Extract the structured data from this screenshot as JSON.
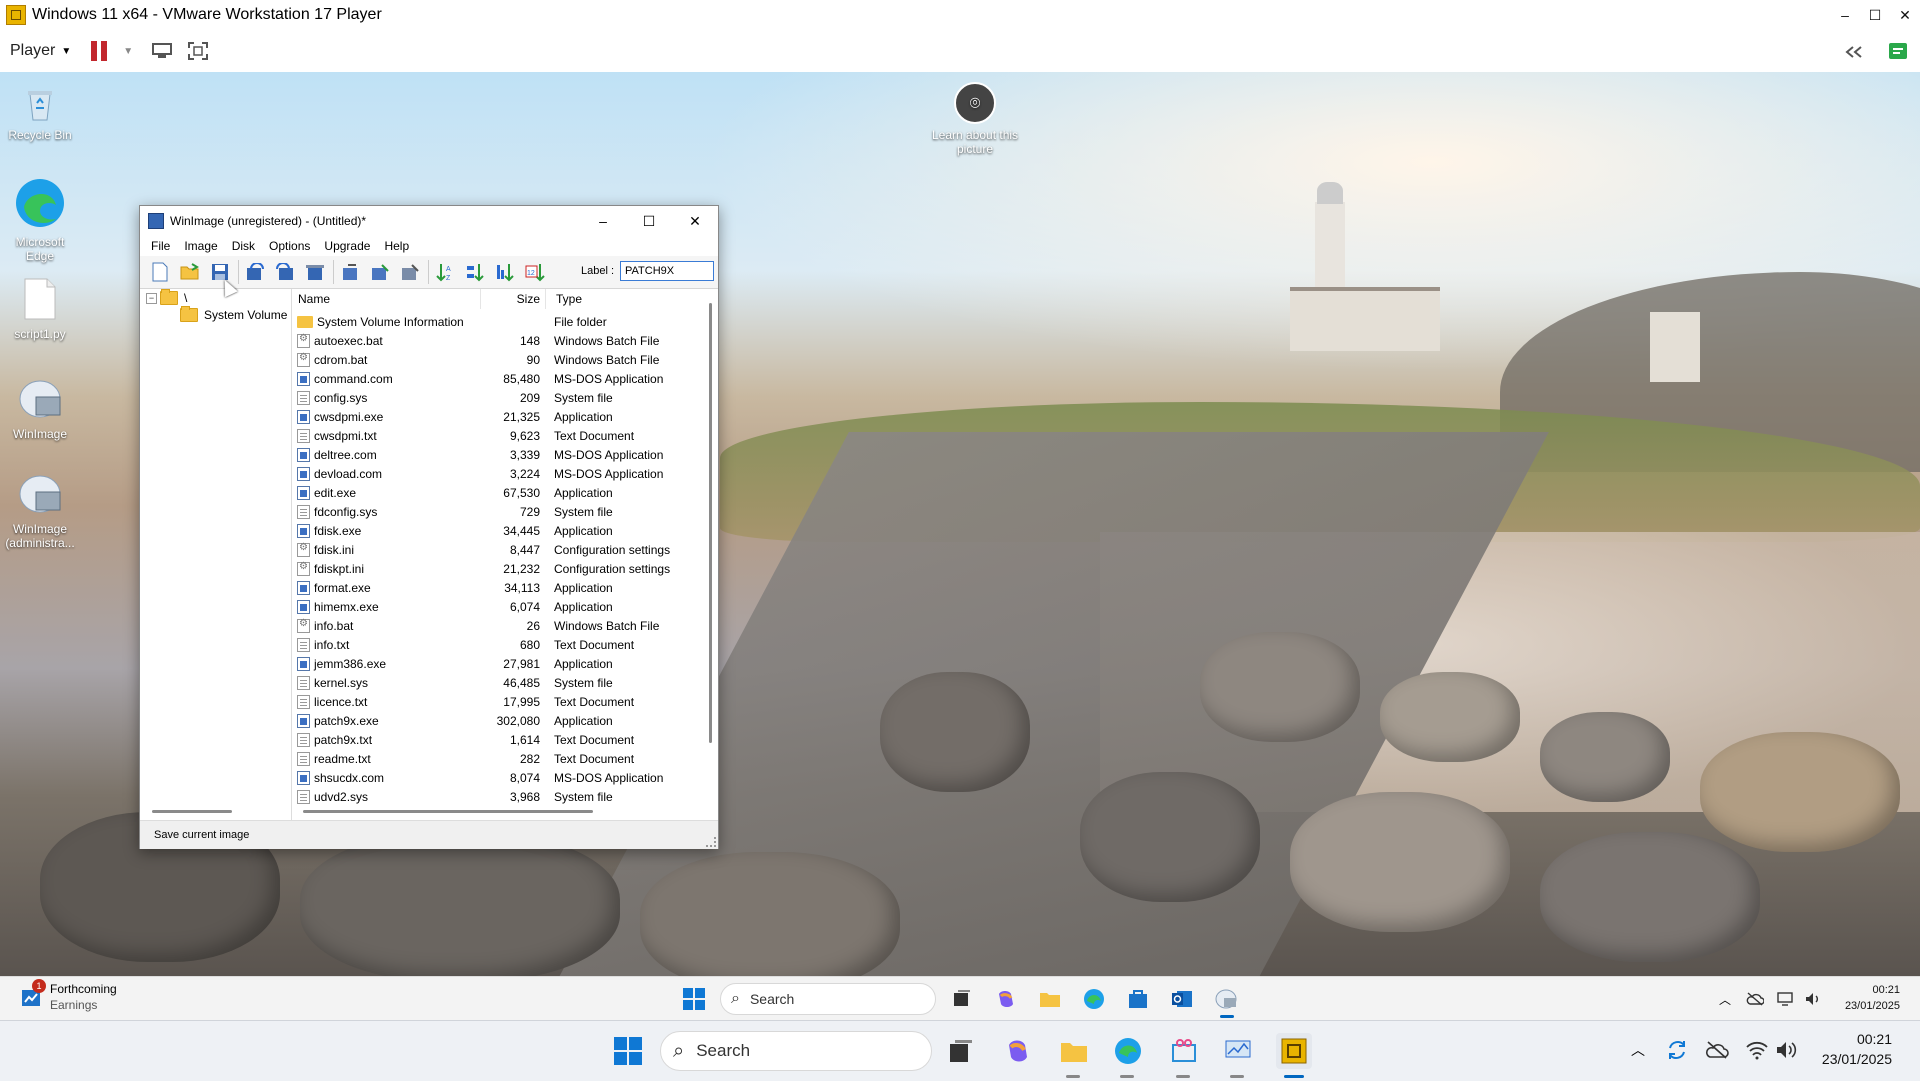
{
  "host": {
    "title": "Windows 11 x64 - VMware Workstation 17 Player",
    "player_menu": "Player",
    "window_buttons": [
      "–",
      "☐",
      "✕"
    ]
  },
  "desktop": {
    "icons": [
      {
        "label": "Recycle Bin"
      },
      {
        "label": "Microsoft Edge"
      },
      {
        "label": "script1.py"
      },
      {
        "label": "WinImage"
      },
      {
        "label": "WinImage (administra..."
      }
    ],
    "learn": "Learn about this picture"
  },
  "winimage": {
    "title": "WinImage (unregistered) - (Untitled)*",
    "menu": [
      "File",
      "Image",
      "Disk",
      "Options",
      "Upgrade",
      "Help"
    ],
    "label_caption": "Label :",
    "label_value": "PATCH9X",
    "tree": {
      "root": "\\",
      "child": "System Volume I"
    },
    "columns": {
      "name": "Name",
      "size": "Size",
      "type": "Type"
    },
    "files": [
      {
        "name": "System Volume Information",
        "size": "",
        "type": "File folder",
        "icon": "folder"
      },
      {
        "name": "autoexec.bat",
        "size": "148",
        "type": "Windows Batch File",
        "icon": "bat"
      },
      {
        "name": "cdrom.bat",
        "size": "90",
        "type": "Windows Batch File",
        "icon": "bat"
      },
      {
        "name": "command.com",
        "size": "85,480",
        "type": "MS-DOS Application",
        "icon": "app"
      },
      {
        "name": "config.sys",
        "size": "209",
        "type": "System file",
        "icon": "doc"
      },
      {
        "name": "cwsdpmi.exe",
        "size": "21,325",
        "type": "Application",
        "icon": "app"
      },
      {
        "name": "cwsdpmi.txt",
        "size": "9,623",
        "type": "Text Document",
        "icon": "doc"
      },
      {
        "name": "deltree.com",
        "size": "3,339",
        "type": "MS-DOS Application",
        "icon": "app"
      },
      {
        "name": "devload.com",
        "size": "3,224",
        "type": "MS-DOS Application",
        "icon": "app"
      },
      {
        "name": "edit.exe",
        "size": "67,530",
        "type": "Application",
        "icon": "app"
      },
      {
        "name": "fdconfig.sys",
        "size": "729",
        "type": "System file",
        "icon": "doc"
      },
      {
        "name": "fdisk.exe",
        "size": "34,445",
        "type": "Application",
        "icon": "app"
      },
      {
        "name": "fdisk.ini",
        "size": "8,447",
        "type": "Configuration settings",
        "icon": "bat"
      },
      {
        "name": "fdiskpt.ini",
        "size": "21,232",
        "type": "Configuration settings",
        "icon": "bat"
      },
      {
        "name": "format.exe",
        "size": "34,113",
        "type": "Application",
        "icon": "app"
      },
      {
        "name": "himemx.exe",
        "size": "6,074",
        "type": "Application",
        "icon": "app"
      },
      {
        "name": "info.bat",
        "size": "26",
        "type": "Windows Batch File",
        "icon": "bat"
      },
      {
        "name": "info.txt",
        "size": "680",
        "type": "Text Document",
        "icon": "doc"
      },
      {
        "name": "jemm386.exe",
        "size": "27,981",
        "type": "Application",
        "icon": "app"
      },
      {
        "name": "kernel.sys",
        "size": "46,485",
        "type": "System file",
        "icon": "doc"
      },
      {
        "name": "licence.txt",
        "size": "17,995",
        "type": "Text Document",
        "icon": "doc"
      },
      {
        "name": "patch9x.exe",
        "size": "302,080",
        "type": "Application",
        "icon": "app"
      },
      {
        "name": "patch9x.txt",
        "size": "1,614",
        "type": "Text Document",
        "icon": "doc"
      },
      {
        "name": "readme.txt",
        "size": "282",
        "type": "Text Document",
        "icon": "doc"
      },
      {
        "name": "shsucdx.com",
        "size": "8,074",
        "type": "MS-DOS Application",
        "icon": "app"
      },
      {
        "name": "udvd2.sys",
        "size": "3,968",
        "type": "System file",
        "icon": "doc"
      }
    ],
    "status": "Save current image"
  },
  "guest_taskbar": {
    "widget_title": "Forthcoming",
    "widget_sub": "Earnings",
    "widget_badge": "1",
    "search": "Search",
    "time": "00:21",
    "date": "23/01/2025"
  },
  "host_taskbar": {
    "search": "Search",
    "time": "00:21",
    "date": "23/01/2025"
  },
  "colors": {
    "accent": "#0067c0",
    "vm_pause": "#c2272d"
  }
}
